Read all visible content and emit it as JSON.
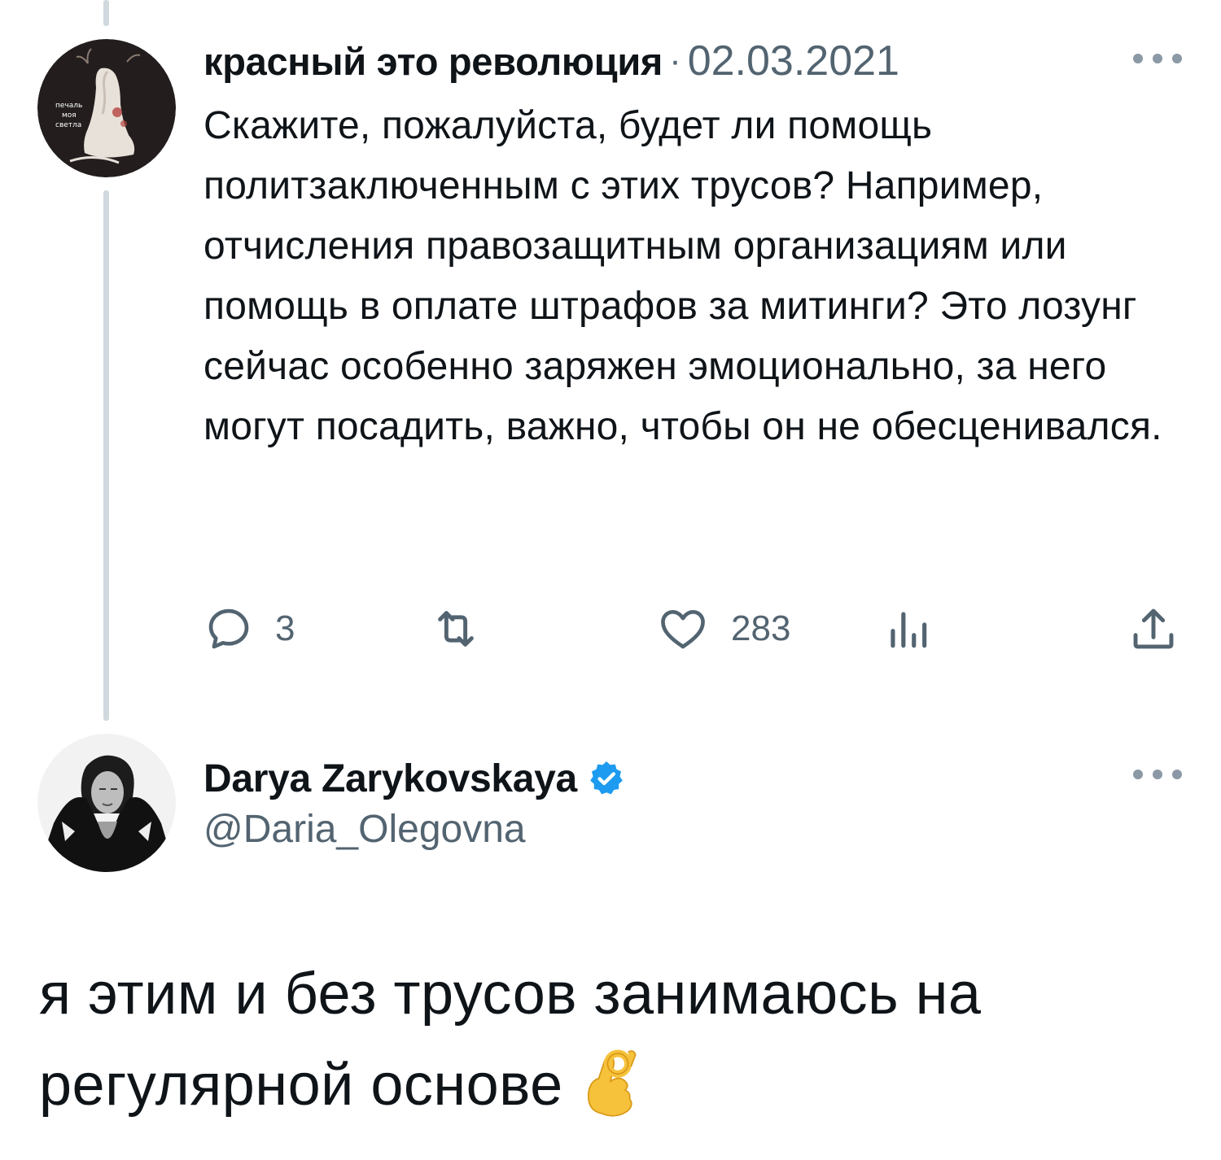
{
  "reply_tweet": {
    "author_name": "красный это революция",
    "separator": "·",
    "date": "02.03.2021",
    "avatar_text": [
      "печаль",
      "моя",
      "светла"
    ],
    "text": "Скажите, пожалуйста, будет ли помощь политзаключенным с этих трусов? Например, отчисления правозащитным организациям или помощь в оплате штрафов за митинги? Это лозунг сейчас особенно заряжен эмоционально, за него могут посадить, важно, чтобы он не обесценивался.",
    "actions": {
      "reply_icon": "speech-bubble-icon",
      "reply_count": "3",
      "retweet_icon": "retweet-arrows-icon",
      "like_icon": "heart-icon",
      "like_count": "283",
      "analytics_icon": "bar-chart-icon",
      "share_icon": "share-upload-icon"
    }
  },
  "main_tweet": {
    "author_name": "Darya Zarykovskaya",
    "verified_icon": "verified-badge-icon",
    "handle": "@Daria_Olegovna",
    "text": "я этим и без трусов занимаюсь на регулярной основе",
    "emoji_icon": "ok-hand-emoji-icon"
  },
  "colors": {
    "text_primary": "#0f1419",
    "text_secondary": "#536471",
    "thread_line": "#cfd9de",
    "verified_blue": "#1d9bf0",
    "background": "#ffffff"
  }
}
